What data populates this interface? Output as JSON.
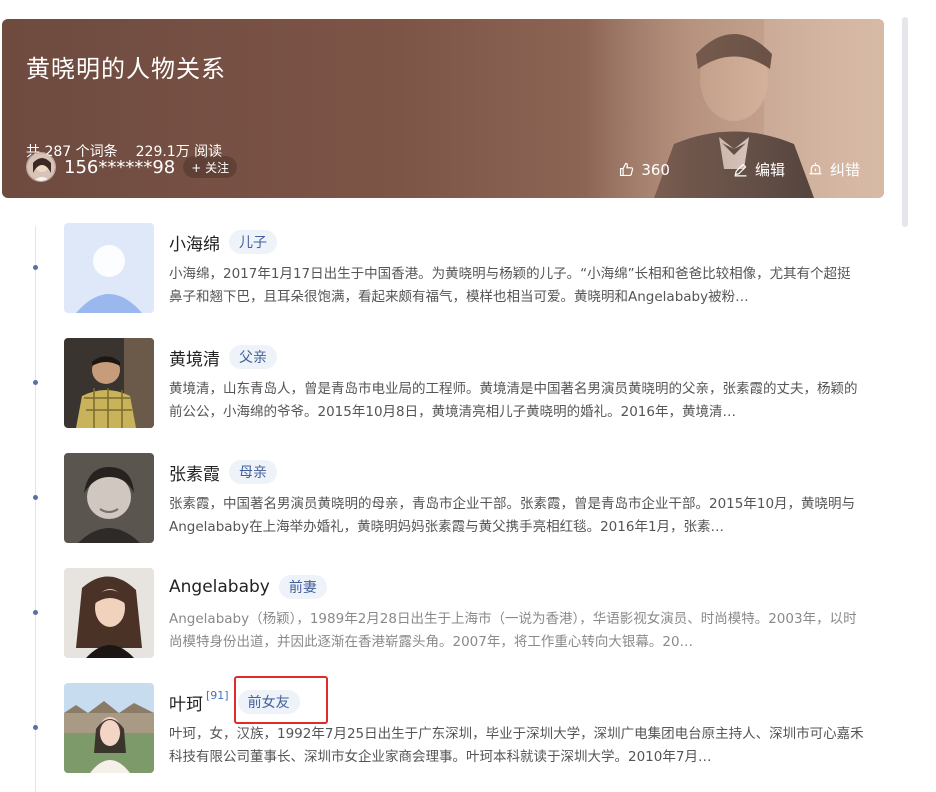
{
  "header": {
    "title": "黄晓明的人物关系",
    "entry_count": "共 287 个词条",
    "views": "229.1万 阅读",
    "username": "156******98",
    "follow_label": "+ 关注",
    "like_count": "360",
    "edit_label": "编辑",
    "report_label": "纠错"
  },
  "relations": [
    {
      "name": "小海绵",
      "ref": "",
      "tag": "儿子",
      "desc": "小海绵，2017年1月17日出生于中国香港。为黄晓明与杨颖的儿子。“小海绵”长相和爸爸比较相像，尤其有个超挺鼻子和翘下巴，且耳朵很饱满，看起来颇有福气，模样也相当可爱。黄晓明和Angelababy被粉…"
    },
    {
      "name": "黄境清",
      "ref": "",
      "tag": "父亲",
      "desc": "黄境清，山东青岛人，曾是青岛市电业局的工程师。黄境清是中国著名男演员黄晓明的父亲，张素霞的丈夫，杨颖的前公公，小海绵的爷爷。2015年10月8日，黄境清亮相儿子黄晓明的婚礼。2016年，黄境清…"
    },
    {
      "name": "张素霞",
      "ref": "",
      "tag": "母亲",
      "desc": "张素霞，中国著名男演员黄晓明的母亲，青岛市企业干部。张素霞，曾是青岛市企业干部。2015年10月，黄晓明与Angelababy在上海举办婚礼，黄晓明妈妈张素霞与黄父携手亮相红毯。2016年1月，张素…"
    },
    {
      "name": "Angelababy",
      "ref": "",
      "tag": "前妻",
      "desc": "Angelababy（杨颖），1989年2月28日出生于上海市（一说为香港），华语影视女演员、时尚模特。2003年，以时尚模特身份出道，并因此逐渐在香港崭露头角。2007年，将工作重心转向大银幕。20…"
    },
    {
      "name": "叶珂",
      "ref": "[91]",
      "tag": "前女友",
      "desc": "叶珂，女，汉族，1992年7月25日出生于广东深圳，毕业于深圳大学，深圳广电集团电台原主持人、深圳市可心嘉禾科技有限公司董事长、深圳市女企业家商会理事。叶珂本科就读于深圳大学。2010年7月…"
    }
  ],
  "colors": {
    "header_bg": "#7a5346",
    "tag_bg": "#eef2f9",
    "tag_text": "#44609a",
    "highlight": "#e02b2b"
  }
}
